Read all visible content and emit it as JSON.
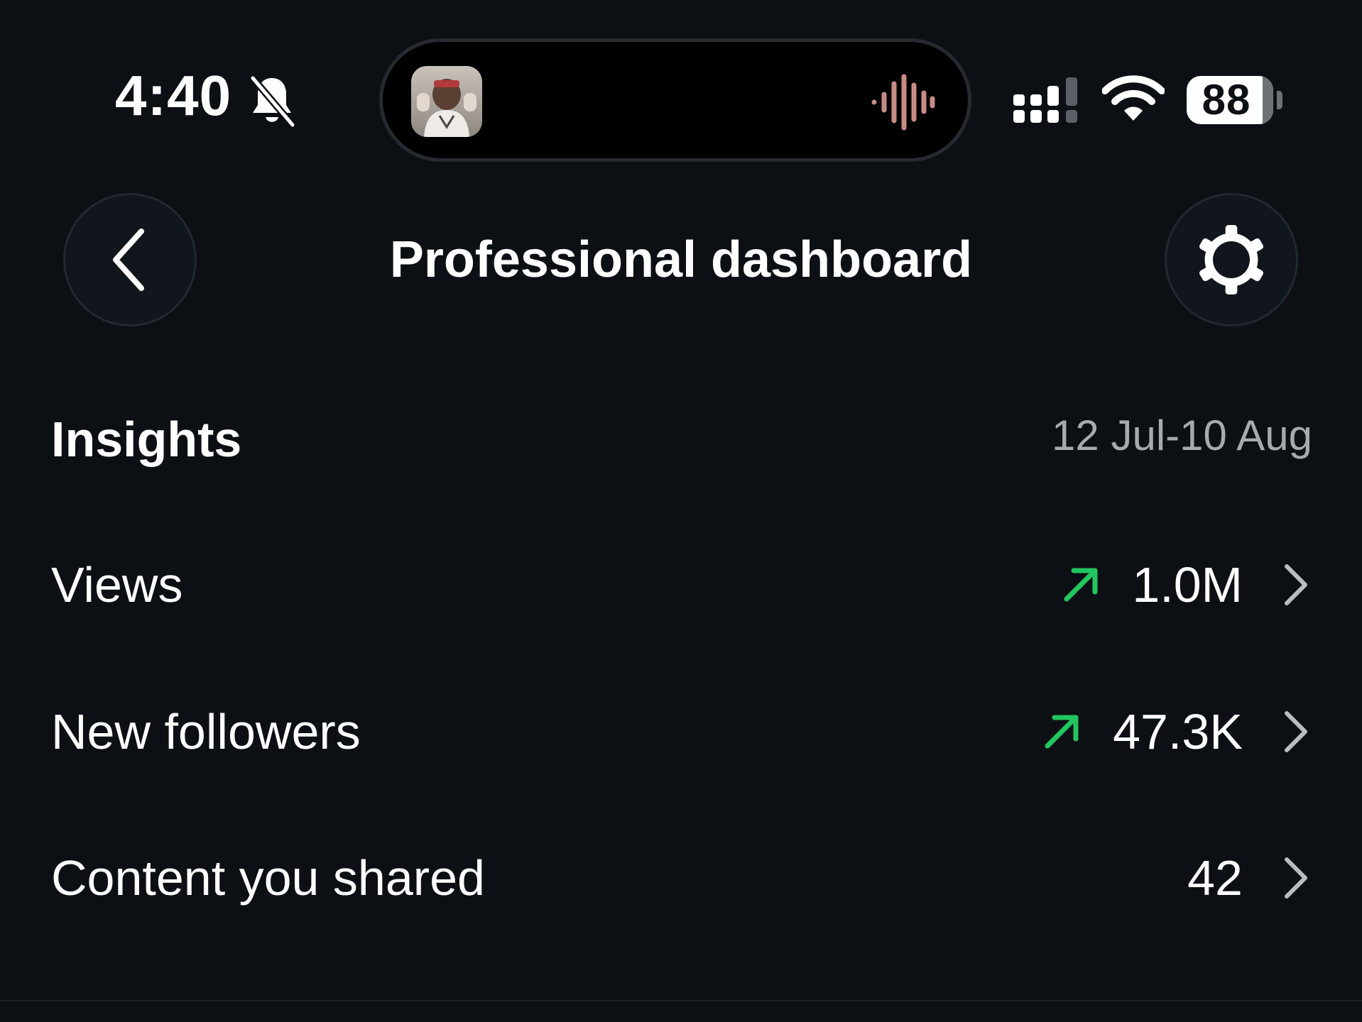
{
  "status_bar": {
    "time": "4:40",
    "battery_level": "88",
    "battery_fraction": 0.88,
    "icons": [
      "bell-slash-icon",
      "waveform-icon",
      "cellular-signal-icon",
      "wifi-icon",
      "battery-icon"
    ],
    "waveform_color": "#c98b86"
  },
  "header": {
    "title": "Professional dashboard",
    "back_icon": "chevron-left-icon",
    "settings_icon": "gear-icon"
  },
  "insights": {
    "heading": "Insights",
    "date_range": "12 Jul-10 Aug",
    "rows": [
      {
        "label": "Views",
        "value": "1.0M",
        "trend": "up"
      },
      {
        "label": "New followers",
        "value": "47.3K",
        "trend": "up"
      },
      {
        "label": "Content you shared",
        "value": "42",
        "trend": ""
      }
    ]
  },
  "colors": {
    "background": "#0c1015",
    "trend_up": "#22c55e",
    "muted_text": "#a7aaaf",
    "chevron": "#b9bcc0"
  }
}
